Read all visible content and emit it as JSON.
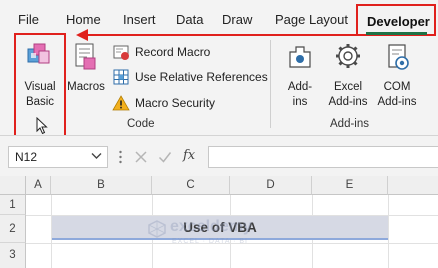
{
  "menu": {
    "tabs": [
      "File",
      "Home",
      "Insert",
      "Data",
      "Draw",
      "Page Layout"
    ],
    "active_tab": "Developer"
  },
  "ribbon": {
    "code_group": {
      "label": "Code",
      "visual_basic": [
        "Visual",
        "Basic"
      ],
      "macros": "Macros",
      "record_macro": "Record Macro",
      "relative_refs": "Use Relative References",
      "macro_security": "Macro Security"
    },
    "addins_group": {
      "label": "Add-ins",
      "addins": [
        "Add-",
        "ins"
      ],
      "excel_addins": [
        "Excel",
        "Add-ins"
      ],
      "com_addins": [
        "COM",
        "Add-ins"
      ]
    }
  },
  "formula_bar": {
    "name_box": "N12",
    "fx": "fx",
    "formula": ""
  },
  "sheet": {
    "columns": [
      "A",
      "B",
      "C",
      "D",
      "E"
    ],
    "rows": [
      "1",
      "2",
      "3"
    ],
    "title_cell": "Use of VBA"
  },
  "watermark": {
    "name": "exceldemy",
    "tagline": "EXCEL · DATA · BI"
  },
  "colors": {
    "highlight_red": "#e0201c",
    "tab_underline": "#1e7145",
    "title_fill": "#d6d9e4",
    "title_border": "#8ea9db"
  }
}
